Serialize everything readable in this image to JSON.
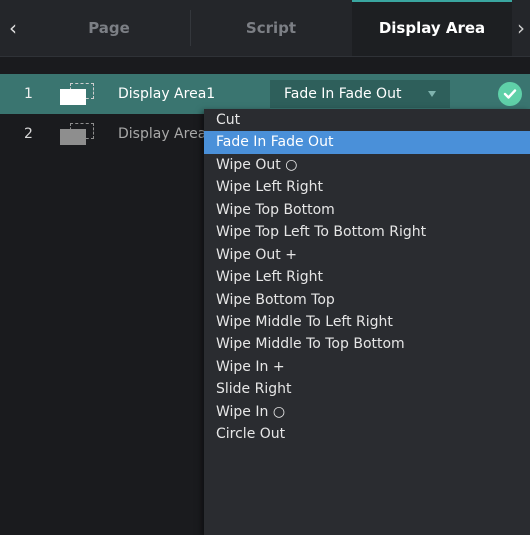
{
  "tabs": [
    {
      "label": "Page"
    },
    {
      "label": "Script"
    },
    {
      "label": "Display Area"
    }
  ],
  "rows": [
    {
      "index": "1",
      "name": "Display Area1",
      "effect": "Fade In Fade Out",
      "checked": true
    },
    {
      "index": "2",
      "name": "Display Area2"
    }
  ],
  "dropdown": {
    "selected": "Fade In Fade Out",
    "items": [
      "Cut",
      "Fade In Fade Out",
      "Wipe Out ○",
      "Wipe Left Right",
      "Wipe Top Bottom",
      "Wipe Top Left To Bottom Right",
      "Wipe Out +",
      "Wipe Left Right",
      "Wipe Bottom Top",
      "Wipe Middle To Left Right",
      "Wipe Middle To Top Bottom",
      "Wipe In +",
      "Slide Right",
      "Wipe In ○",
      "Circle Out"
    ]
  },
  "colors": {
    "accent": "#3a7570",
    "selection": "#4a90d9",
    "check": "#5fd0a8"
  },
  "icons": {
    "nav_left": "chevron-left-icon",
    "nav_right": "chevron-right-icon",
    "area": "display-area-icon",
    "dropdown_caret": "caret-down-icon",
    "status": "check-circle-icon"
  }
}
